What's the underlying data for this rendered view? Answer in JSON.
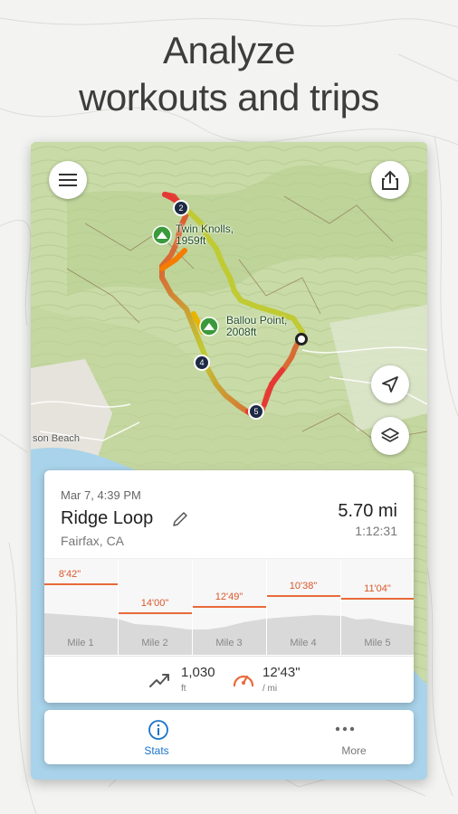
{
  "headline": {
    "line1": "Analyze",
    "line2": "workouts and trips"
  },
  "map": {
    "peaks": [
      {
        "name_line1": "Twin Knolls,",
        "name_line2": "1959ft"
      },
      {
        "name_line1": "Ballou Point,",
        "name_line2": "2008ft"
      }
    ],
    "city_label": "son Beach",
    "markers": [
      "2",
      "4",
      "5"
    ],
    "icons": {
      "menu": "menu-icon",
      "share": "share-icon",
      "locate": "navigation-arrow-icon",
      "layers": "layers-icon",
      "peak": "mountain-icon"
    }
  },
  "workout": {
    "date": "Mar 7, 4:39 PM",
    "title": "Ridge Loop",
    "location": "Fairfax, CA",
    "distance": "5.70 mi",
    "duration": "1:12:31",
    "splits": [
      {
        "pace": "8'42\"",
        "label": "Mile 1"
      },
      {
        "pace": "14'00\"",
        "label": "Mile 2"
      },
      {
        "pace": "12'49\"",
        "label": "Mile 3"
      },
      {
        "pace": "10'38\"",
        "label": "Mile 4"
      },
      {
        "pace": "11'04\"",
        "label": "Mile 5"
      }
    ],
    "elevation": {
      "value": "1,030",
      "unit": "ft"
    },
    "avg_pace": {
      "value": "12'43\"",
      "unit": "/ mi"
    }
  },
  "tabs": [
    {
      "label": "Stats",
      "icon": "info-icon",
      "active": true
    },
    {
      "label": "More",
      "icon": "more-dots-icon",
      "active": false
    }
  ],
  "colors": {
    "accent": "#1a73c9",
    "pace": "#e86a3b",
    "route_fast": "#8bc34a",
    "route_slow": "#e53935"
  }
}
